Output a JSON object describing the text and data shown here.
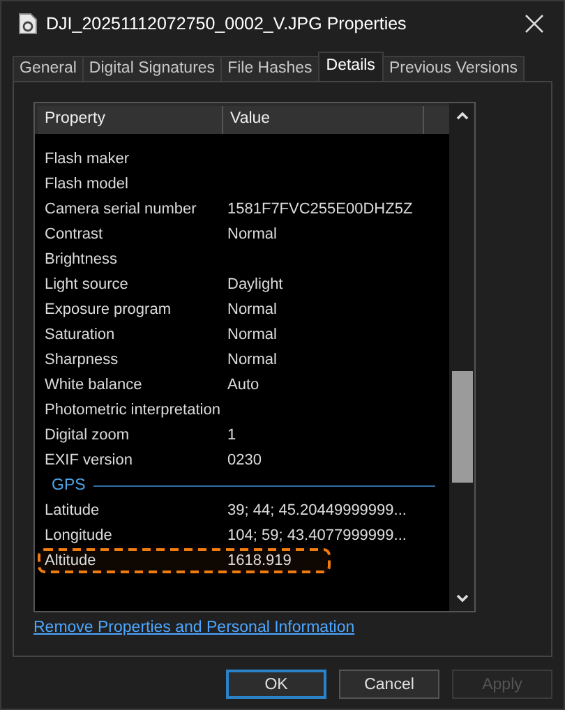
{
  "window": {
    "title": "DJI_20251112072750_0002_V.JPG Properties"
  },
  "tabs": [
    {
      "label": "General",
      "selected": false
    },
    {
      "label": "Digital Signatures",
      "selected": false
    },
    {
      "label": "File Hashes",
      "selected": false
    },
    {
      "label": "Details",
      "selected": true
    },
    {
      "label": "Previous Versions",
      "selected": false
    }
  ],
  "table": {
    "columns": [
      "Property",
      "Value"
    ],
    "rows": [
      {
        "kind": "row",
        "property": "Flash maker",
        "annotated": false
      },
      {
        "kind": "row",
        "property": "Flash model",
        "annotated": false
      },
      {
        "kind": "row",
        "property": "Camera serial number",
        "value": "1581F7FVC255E00DHZ5Z",
        "annotated": false
      },
      {
        "kind": "row",
        "property": "Contrast",
        "value": "Normal",
        "annotated": false
      },
      {
        "kind": "row",
        "property": "Brightness",
        "annotated": false
      },
      {
        "kind": "row",
        "property": "Light source",
        "value": "Daylight",
        "annotated": false
      },
      {
        "kind": "row",
        "property": "Exposure program",
        "value": "Normal",
        "annotated": false
      },
      {
        "kind": "row",
        "property": "Saturation",
        "value": "Normal",
        "annotated": false
      },
      {
        "kind": "row",
        "property": "Sharpness",
        "value": "Normal",
        "annotated": false
      },
      {
        "kind": "row",
        "property": "White balance",
        "value": "Auto",
        "annotated": false
      },
      {
        "kind": "row",
        "property": "Photometric interpretation",
        "annotated": false
      },
      {
        "kind": "row",
        "property": "Digital zoom",
        "value": "1",
        "annotated": false
      },
      {
        "kind": "row",
        "property": "EXIF version",
        "value": "0230",
        "annotated": false
      },
      {
        "kind": "group",
        "property": "GPS"
      },
      {
        "kind": "row",
        "property": "Latitude",
        "value": "39; 44; 45.20449999999...",
        "annotated": false
      },
      {
        "kind": "row",
        "property": "Longitude",
        "value": "104; 59; 43.4077999999...",
        "annotated": false
      },
      {
        "kind": "row",
        "property": "Altitude",
        "value": "1618.919",
        "annotated": true
      }
    ]
  },
  "link": "Remove Properties and Personal Information",
  "buttons": [
    {
      "label": "OK",
      "default": true,
      "disabled": false
    },
    {
      "label": "Cancel",
      "default": false,
      "disabled": false
    },
    {
      "label": "Apply",
      "default": false,
      "disabled": true
    }
  ]
}
